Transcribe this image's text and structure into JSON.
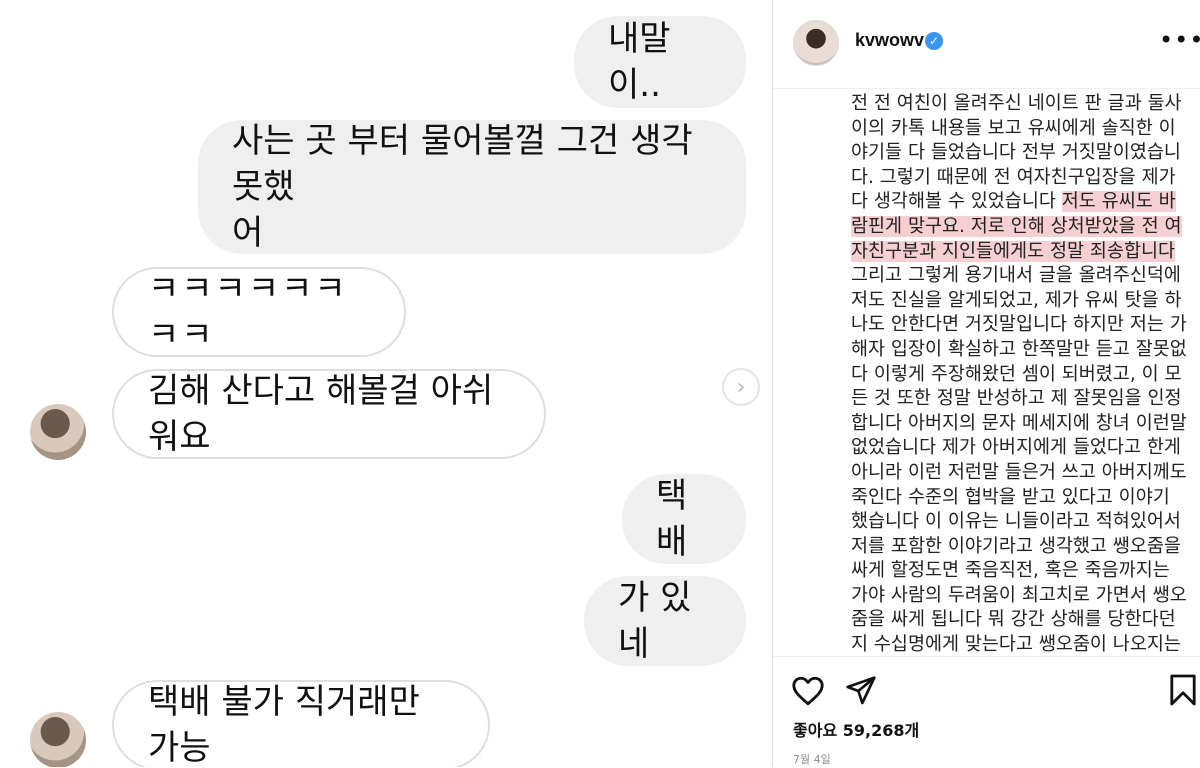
{
  "chat": {
    "messages": [
      {
        "side": "out",
        "text": "내말이.."
      },
      {
        "side": "out",
        "text": "사는 곳 부터 물어볼껄 그건 생각 못했\n어"
      },
      {
        "side": "in",
        "text": "ㅋㅋㅋㅋㅋㅋㅋㅋ"
      },
      {
        "side": "in",
        "text": "김해 산다고 해볼걸 아쉬워요"
      },
      {
        "side": "out",
        "text": "택배"
      },
      {
        "side": "out",
        "text": "가 있네"
      },
      {
        "side": "in",
        "text": "택배 불가 직거래만 가능"
      }
    ]
  },
  "post": {
    "username": "kvwowv",
    "verified_icon": "verified-badge-icon",
    "more_icon": "more-options-icon",
    "caption_before": "전 전 여친이 올려주신 네이트 판 글과 둘사이의 카톡 내용들 보고 유씨에게 솔직한 이야기들 다 들었습니다 전부 거짓말이였습니다. 그렇기 때문에 전 여자친구입장을 제가 다 생각해볼 수 있었습니다 ",
    "caption_highlight": "저도 유씨도 바람핀게 맞구요. 저로 인해 상처받았을 전 여자친구분과 지인들에게도 정말 죄송합니다",
    "caption_after": " 그리고 그렇게 용기내서 글을 올려주신덕에 저도 진실을 알게되었고, 제가 유씨 탓을 하나도 안한다면 거짓말입니다 하지만 저는 가해자 입장이 확실하고 한쪽말만 듣고 잘못없다 이렇게 주장해왔던 셈이 되버렸고, 이 모든 것 또한 정말 반성하고 제 잘못임을 인정합니다 아버지의 문자 메세지에 창녀 이런말 없었습니다 제가 아버지에게 들었다고 한게 아니라 이런 저런말 들은거 쓰고 아버지께도 죽인다 수준의 협박을 받고 있다고 이야기 했습니다 이 이유는 니들이라고 적혀있어서 저를 포함한 이야기라고 생각했고 쌩오줌을 싸게 할정도면 죽음직전, 혹은 죽음까지는 가야 사람의 두려움이 최고치로 가면서 쌩오줌을 싸게 됩니다 뭐 강간 상해를 당한다던지 수십명에게 맞는다고 쌩오줌이 나오지는 않습",
    "likes": "좋아요 59,268개",
    "date": "7월 4일",
    "highlight_color": "#f6cfd2",
    "accent_color": "#3897f0"
  }
}
